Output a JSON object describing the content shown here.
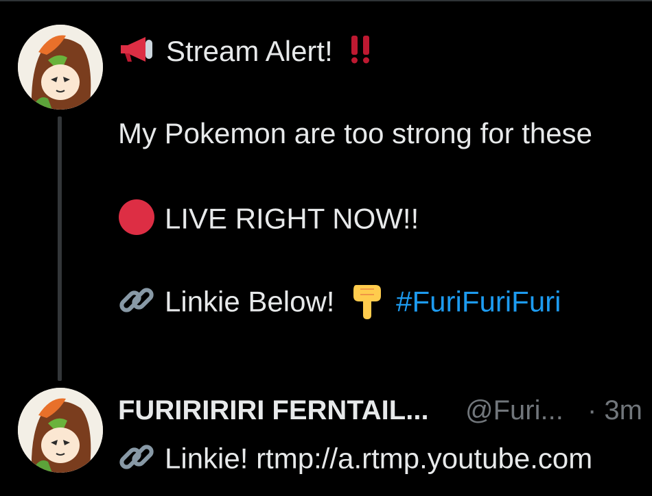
{
  "colors": {
    "background": "#000000",
    "text": "#e7e9ea",
    "muted": "#71767b",
    "link": "#1d9bf0",
    "thread_line": "#333639",
    "alert_red": "#e0254a"
  },
  "tweet": {
    "line1": "Stream Alert!",
    "line1_icons": [
      "megaphone-icon",
      "double-exclamation-icon"
    ],
    "line2": "My Pokemon are too strong for these",
    "line3": "LIVE RIGHT NOW!!",
    "line3_icon": "red-circle-icon",
    "line4": "Linkie Below!",
    "line4_icons": [
      "link-icon",
      "pointing-down-icon"
    ],
    "hashtag": "#FuriFuriFuri"
  },
  "reply": {
    "display_name": "FURIRIRIRI FERNTAIL...",
    "handle": "@Furi...",
    "time": "· 3m",
    "text": "Linkie! rtmp://a.rtmp.youtube.com",
    "text_icon": "link-icon"
  }
}
